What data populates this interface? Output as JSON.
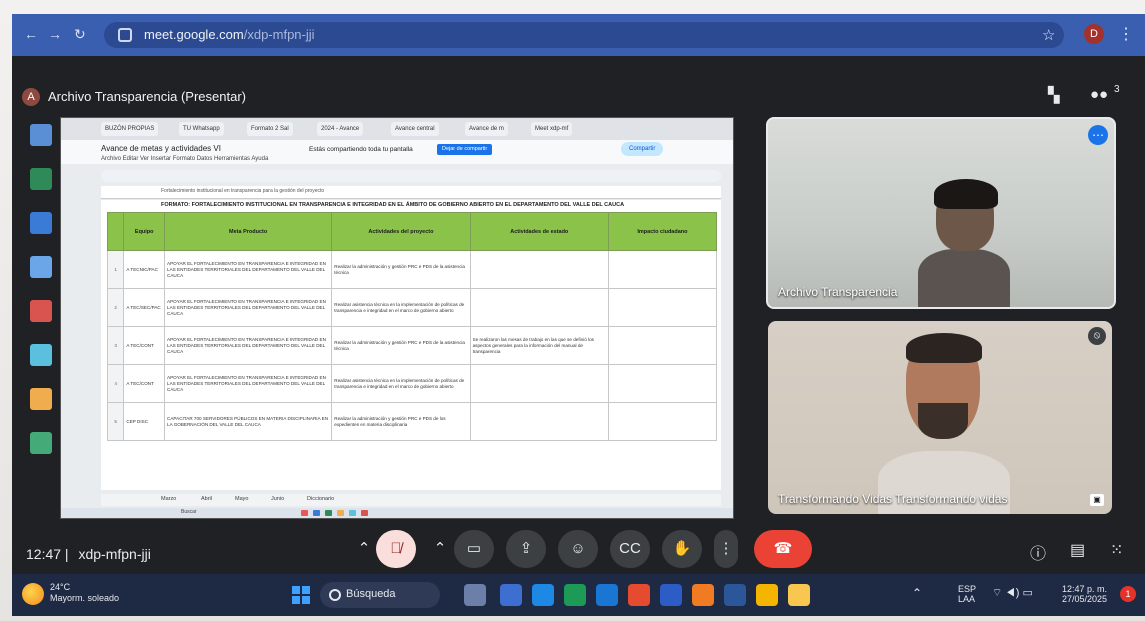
{
  "browser": {
    "url_host": "meet.google.com",
    "url_path": "/xdp-mfpn-jji",
    "profile_initial": "D"
  },
  "meet": {
    "presenter_initial": "A",
    "presenter_title": "Archivo Transparencia (Presentar)",
    "participant_count": "3",
    "time": "12:47",
    "meeting_code": "xdp-mfpn-jji",
    "tiles": [
      {
        "name": "Archivo Transparencia"
      },
      {
        "name": "Transformando Vidas Transformando vidas"
      }
    ]
  },
  "shared": {
    "tabs": [
      "BUZÓN PROPIAS",
      "TU Whatsapp",
      "Formato 2 Sal",
      "2024 - Avance",
      "Avance central",
      "Avance de m",
      "Meet xdp-mf"
    ],
    "doc_title": "Avance de metas y actividades VI",
    "menu": "Archivo  Editar  Ver  Insertar  Formato  Datos  Herramientas  Ayuda",
    "shared_banner": "Estás compartiendo toda tu pantalla",
    "stop_label": "Dejar de compartir",
    "share_label": "Compartir",
    "formula": "Fortalecimiento institucional en transparencia para la gestión del proyecto",
    "sheet_title": "FORMATO: FORTALECIMIENTO INSTITUCIONAL EN TRANSPARENCIA E INTEGRIDAD EN EL ÁMBITO DE GOBIERNO ABIERTO EN EL DEPARTAMENTO DEL VALLE DEL CAUCA",
    "columns": [
      "Equipo",
      "Meta Producto",
      "Actividades del proyecto",
      "Actividades de estado",
      "Impacto ciudadano"
    ],
    "rows": [
      {
        "n": "1",
        "equipo": "A TECNIC/PAC",
        "meta": "APOYAR EL FORTALECIMIENTO EN TRANSPARENCIA E INTEGRIDAD EN LAS ENTIDADES TERRITORIALES DEL DEPARTAMENTO DEL VALLE DEL CAUCA",
        "act": "Realizar la administración y gestión PRC e PDS de la asistencia técnica",
        "estado": "",
        "impacto": ""
      },
      {
        "n": "2",
        "equipo": "A TEC/SEC/PAC",
        "meta": "APOYAR EL FORTALECIMIENTO EN TRANSPARENCIA E INTEGRIDAD EN LAS ENTIDADES TERRITORIALES DEL DEPARTAMENTO DEL VALLE DEL CAUCA",
        "act": "Realizar asistencia técnica en la implementación de políticas de transparencia e integridad en el marco de gobierno abierto",
        "estado": "",
        "impacto": ""
      },
      {
        "n": "3",
        "equipo": "A TEC/CONT",
        "meta": "APOYAR EL FORTALECIMIENTO EN TRANSPARENCIA E INTEGRIDAD EN LAS ENTIDADES TERRITORIALES DEL DEPARTAMENTO DEL VALLE DEL CAUCA",
        "act": "Realizar la administración y gestión PRC e PDS de la asistencia técnica",
        "estado": "Se realizaron las mesas de trabajo en las que se definió los aspectos generales para la información del manual de transparencia",
        "impacto": ""
      },
      {
        "n": "4",
        "equipo": "A TEC/CONT",
        "meta": "APOYAR EL FORTALECIMIENTO EN TRANSPARENCIA E INTEGRIDAD EN LAS ENTIDADES TERRITORIALES DEL DEPARTAMENTO DEL VALLE DEL CAUCA",
        "act": "Realizar asistencia técnica en la implementación de políticas de transparencia e integridad en el marco de gobierno abierto",
        "estado": "",
        "impacto": ""
      },
      {
        "n": "5",
        "equipo": "CEP DISC",
        "meta": "CAPACITAR 700 SERVIDORES PÚBLICOS EN MATERIA DISCIPLINARIA EN LA GOBERNACIÓN DEL VALLE DEL CAUCA",
        "act": "Realizar la administración y gestión PRC e PDS de los expedientes en materia disciplinaria",
        "estado": "",
        "impacto": ""
      }
    ],
    "sheet_tabs": [
      "Marzo",
      "Abril",
      "Mayo",
      "Junio",
      "Diccionario"
    ],
    "win_search": "Buscar"
  },
  "taskbar": {
    "temperature": "24°C",
    "weather": "Mayorm. soleado",
    "search": "Búsqueda",
    "lang1": "ESP",
    "lang2": "LAA",
    "time": "12:47 p. m.",
    "date": "27/05/2025",
    "notifications": "1"
  },
  "colors": {
    "chrome_blue": "#3b5fb0",
    "meet_bg": "#202124",
    "end_call": "#ea4335",
    "sheet_header": "#8bc34a"
  }
}
